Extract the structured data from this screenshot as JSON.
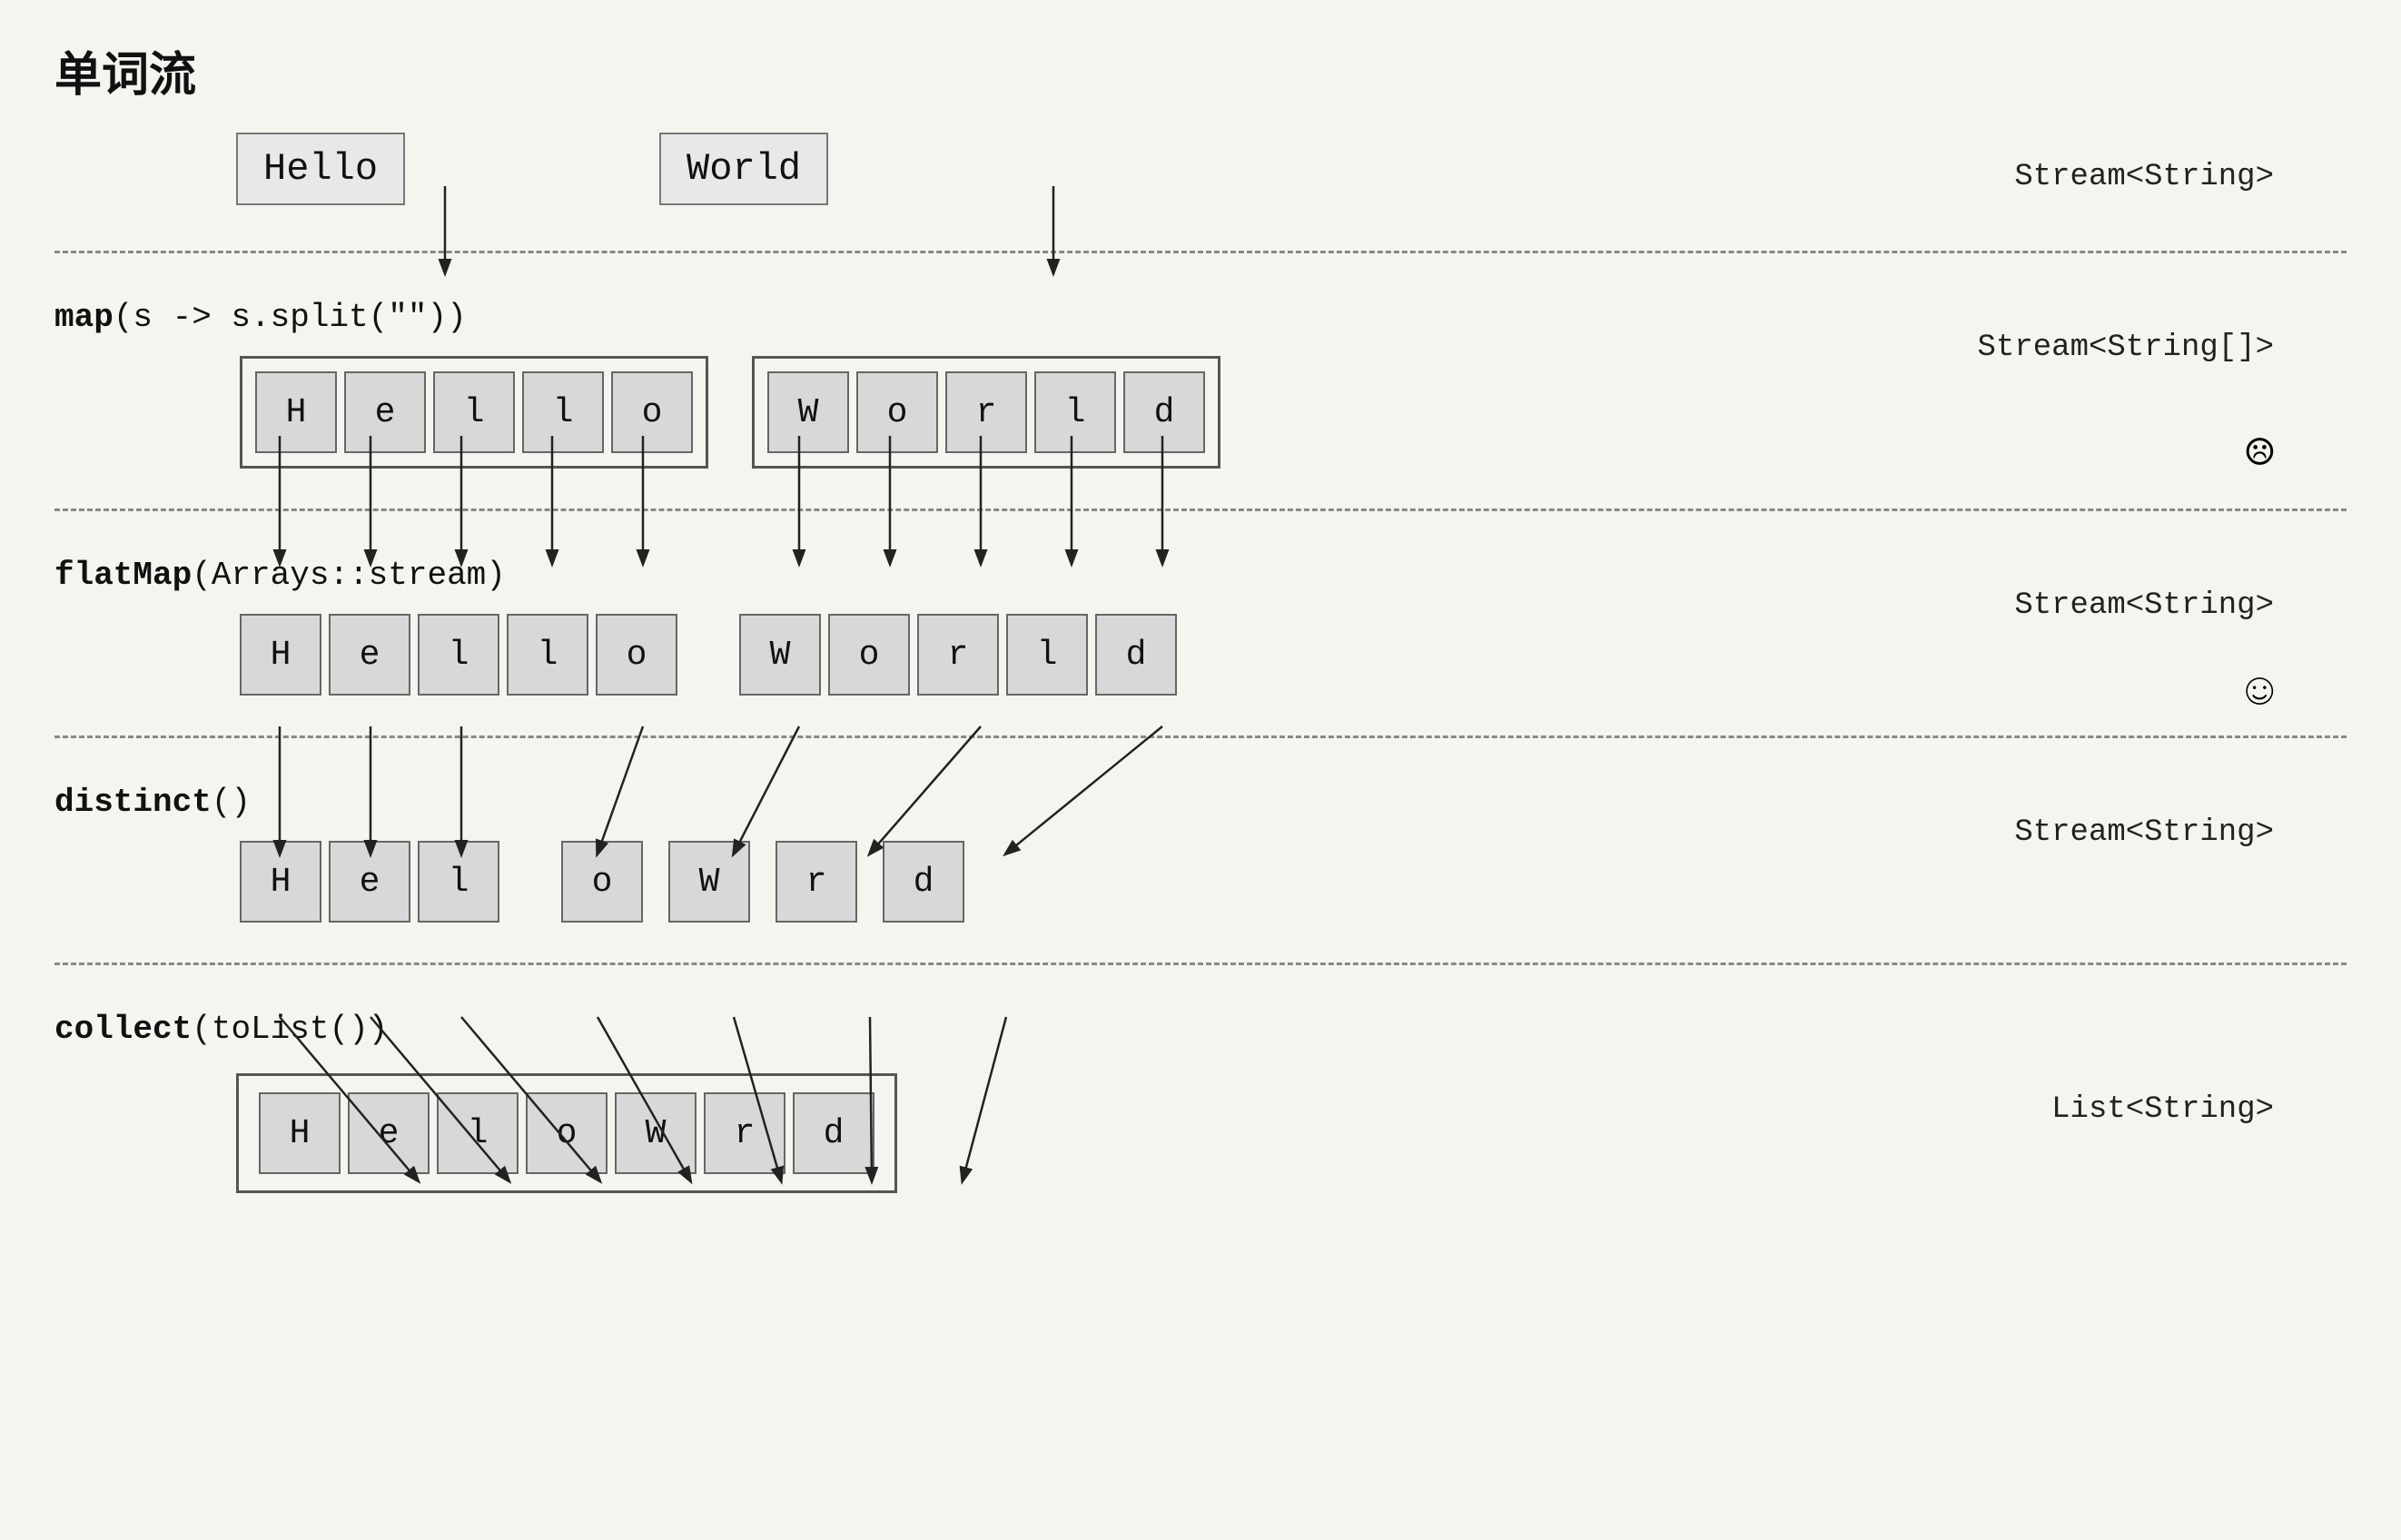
{
  "title": "单词流",
  "colors": {
    "background": "#f5f5f0",
    "box_bg": "#d8d8d8",
    "box_border": "#666"
  },
  "levels": {
    "top": {
      "words": [
        "Hello",
        "World"
      ],
      "stream_type": "Stream<String>"
    },
    "map": {
      "op": "map",
      "op_args": "(s -> s.split(\"\"))",
      "hello_chars": [
        "H",
        "e",
        "l",
        "l",
        "o"
      ],
      "world_chars": [
        "W",
        "o",
        "r",
        "l",
        "d"
      ],
      "stream_type": "Stream<String[]>",
      "emoji": "☹"
    },
    "flatmap": {
      "op": "flatMap",
      "op_args": "(Arrays::stream)",
      "hello_chars": [
        "H",
        "e",
        "l",
        "l",
        "o"
      ],
      "world_chars": [
        "W",
        "o",
        "r",
        "l",
        "d"
      ],
      "stream_type": "Stream<String>",
      "emoji": "☺"
    },
    "distinct": {
      "op": "distinct",
      "op_args": "()",
      "chars": [
        "H",
        "e",
        "l",
        "o",
        "W",
        "r",
        "d"
      ],
      "stream_type": "Stream<String>"
    },
    "collect": {
      "op": "collect",
      "op_args": "(toList())",
      "chars": [
        "H",
        "e",
        "l",
        "o",
        "W",
        "r",
        "d"
      ],
      "stream_type": "List<String>"
    }
  }
}
